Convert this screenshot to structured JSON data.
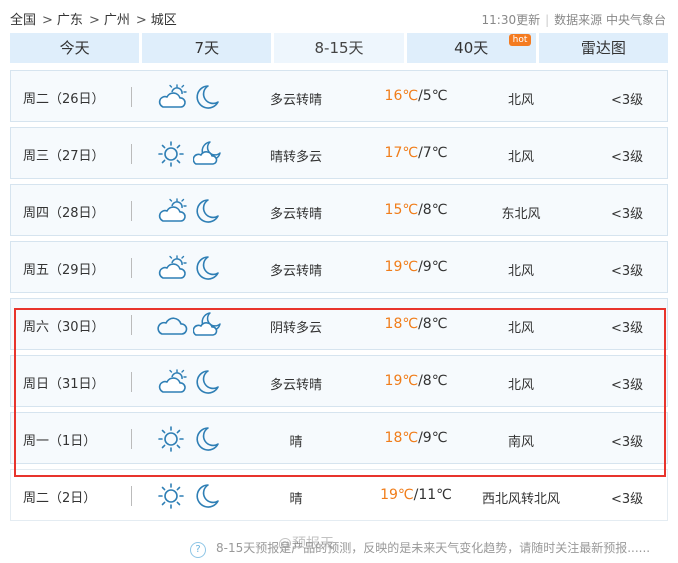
{
  "breadcrumb": {
    "items": [
      "全国",
      "广东",
      "广州",
      "城区"
    ],
    "separator": ">"
  },
  "meta": {
    "updated": "11:30更新",
    "source": "数据来源 中央气象台"
  },
  "tabs": [
    {
      "label": "今天",
      "active": false
    },
    {
      "label": "7天",
      "active": false
    },
    {
      "label": "8-15天",
      "active": true
    },
    {
      "label": "40天",
      "active": false,
      "badge": "hot"
    },
    {
      "label": "雷达图",
      "active": false
    }
  ],
  "forecast": [
    {
      "day": "周二（26日）",
      "icons": [
        "partly-cloudy-sun-icon",
        "moon-icon"
      ],
      "condition": "多云转晴",
      "high": "16℃",
      "low": "/5℃",
      "wind": "北风",
      "level": "<3级"
    },
    {
      "day": "周三（27日）",
      "icons": [
        "sun-icon",
        "cloudy-moon-icon"
      ],
      "condition": "晴转多云",
      "high": "17℃",
      "low": "/7℃",
      "wind": "北风",
      "level": "<3级"
    },
    {
      "day": "周四（28日）",
      "icons": [
        "partly-cloudy-sun-icon",
        "moon-icon"
      ],
      "condition": "多云转晴",
      "high": "15℃",
      "low": "/8℃",
      "wind": "东北风",
      "level": "<3级"
    },
    {
      "day": "周五（29日）",
      "icons": [
        "partly-cloudy-sun-icon",
        "moon-icon"
      ],
      "condition": "多云转晴",
      "high": "19℃",
      "low": "/9℃",
      "wind": "北风",
      "level": "<3级"
    },
    {
      "day": "周六（30日）",
      "icons": [
        "cloud-icon",
        "cloudy-moon-icon"
      ],
      "condition": "阴转多云",
      "high": "18℃",
      "low": "/8℃",
      "wind": "北风",
      "level": "<3级"
    },
    {
      "day": "周日（31日）",
      "icons": [
        "partly-cloudy-sun-icon",
        "moon-icon"
      ],
      "condition": "多云转晴",
      "high": "19℃",
      "low": "/8℃",
      "wind": "北风",
      "level": "<3级"
    },
    {
      "day": "周一（1日）",
      "icons": [
        "sun-icon",
        "moon-icon"
      ],
      "condition": "晴",
      "high": "18℃",
      "low": "/9℃",
      "wind": "南风",
      "level": "<3级"
    },
    {
      "day": "周二（2日）",
      "icons": [
        "sun-icon",
        "moon-icon"
      ],
      "condition": "晴",
      "high": "19℃",
      "low": "/11℃",
      "wind": "西北风转北风",
      "level": "<3级"
    }
  ],
  "footer": {
    "help_icon": "?",
    "note": "8-15天预报是产品的预测，反映的是未来天气变化趋势，请随时关注最新预报......"
  },
  "watermark": "@预报天",
  "colors": {
    "accent": "#f07d1a",
    "icon": "#2f7fb5",
    "highlight": "#e8342c",
    "tab": "#dfeefb"
  }
}
